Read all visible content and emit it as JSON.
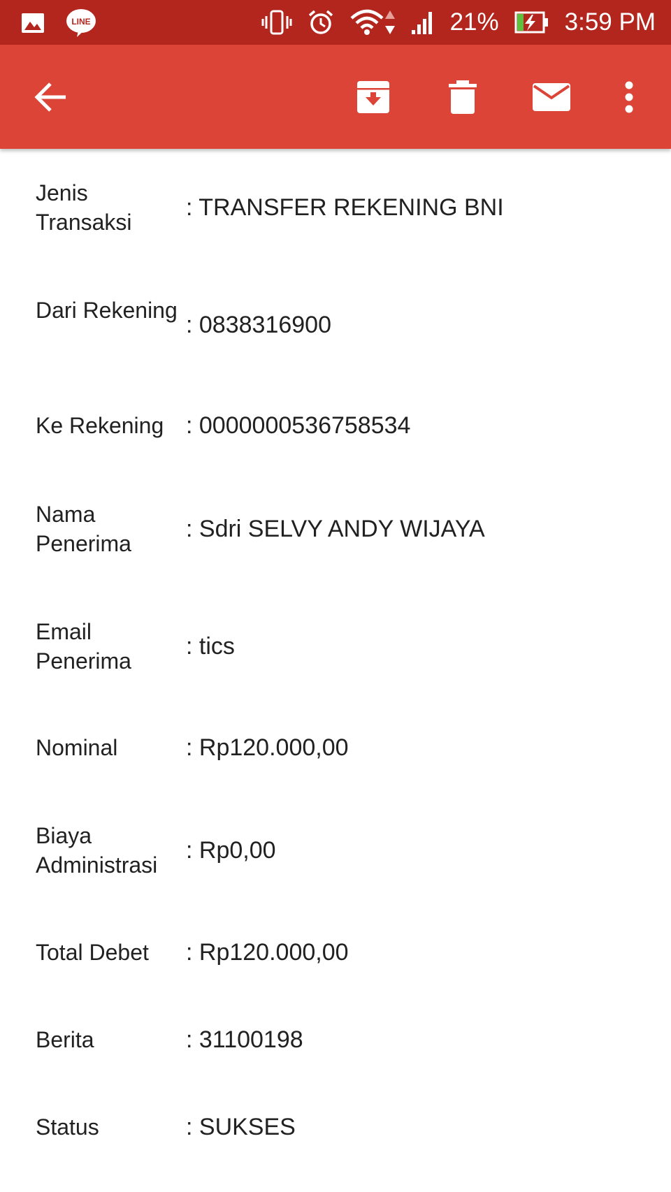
{
  "status_bar": {
    "battery": "21%",
    "time": "3:59 PM",
    "icons": [
      "image-notification-icon",
      "line-app-icon",
      "vibrate-icon",
      "alarm-icon",
      "wifi-icon",
      "data-arrows-icon",
      "signal-icon",
      "battery-charging-icon"
    ]
  },
  "app_bar": {
    "color": "#db4437",
    "icons": [
      "back-arrow-icon",
      "archive-icon",
      "delete-icon",
      "mail-icon",
      "more-vert-icon"
    ]
  },
  "rows": [
    {
      "label": "Jenis Transaksi",
      "value": ": TRANSFER REKENING BNI"
    },
    {
      "label": "Dari Rekening",
      "value": ": 0838316900"
    },
    {
      "label": "Ke Rekening",
      "value": ": 0000000536758534"
    },
    {
      "label": "Nama Penerima",
      "value": ": Sdri SELVY ANDY WIJAYA"
    },
    {
      "label": "Email Penerima",
      "value": ": tics"
    },
    {
      "label": "Nominal",
      "value": ": Rp120.000,00"
    },
    {
      "label": "Biaya Administrasi",
      "value": ": Rp0,00"
    },
    {
      "label": "Total Debet",
      "value": ": Rp120.000,00"
    },
    {
      "label": "Berita",
      "value": ": 31100198"
    },
    {
      "label": "Status",
      "value": ": SUKSES"
    }
  ]
}
